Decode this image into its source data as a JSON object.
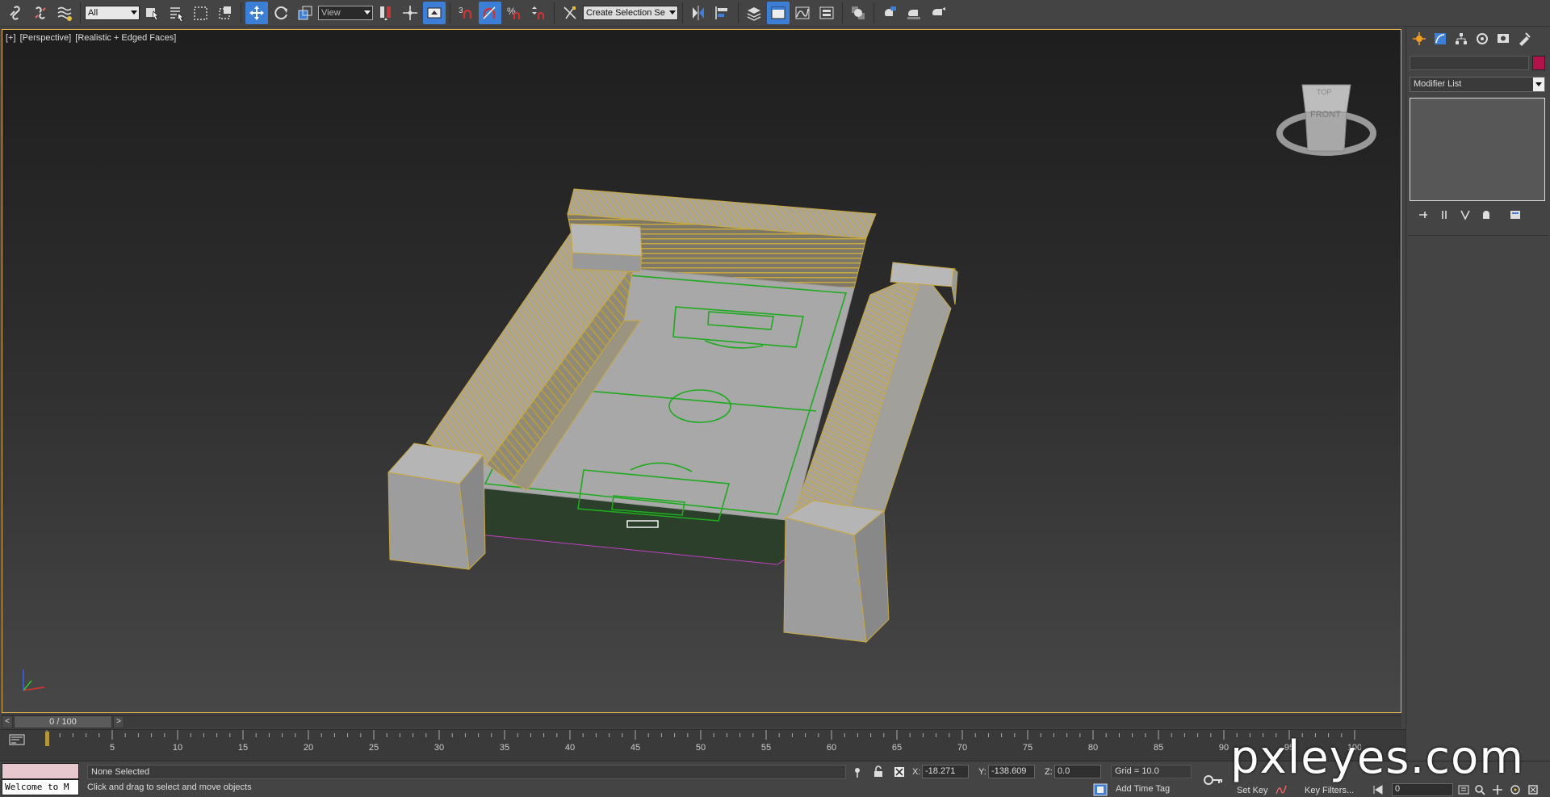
{
  "toolbar": {
    "selection_filter": "All",
    "reference_coord": "View",
    "named_selection": "Create Selection Se"
  },
  "viewport": {
    "label_parts": [
      "[+]",
      "[Perspective]",
      "[Realistic + Edged Faces]"
    ],
    "viewcube": {
      "top_label": "TOP",
      "front_label": "FRONT"
    }
  },
  "command_panel": {
    "modifier_list_label": "Modifier List",
    "object_color": "#b2124a"
  },
  "time_slider": {
    "label": "0 / 100",
    "prev": "<",
    "next": ">",
    "current_frame": 0,
    "total_frames": 100
  },
  "trackbar": {
    "ticks": [
      "5",
      "10",
      "15",
      "20",
      "25",
      "30",
      "35",
      "40",
      "45",
      "50",
      "55",
      "60",
      "65",
      "70",
      "75",
      "80",
      "85",
      "90",
      "95",
      "100"
    ]
  },
  "status": {
    "maxscript_text": "Welcome to M",
    "selection": "None Selected",
    "prompt": "Click and drag to select and move objects",
    "x_label": "X:",
    "x_value": "-18.271",
    "y_label": "Y:",
    "y_value": "-138.609",
    "z_label": "Z:",
    "z_value": "0.0",
    "grid": "Grid = 10.0",
    "add_time_tag": "Add Time Tag",
    "set_key": "Set Key",
    "key_filters": "Key Filters...",
    "frame_value": "0"
  },
  "watermark": "pxleyes.com"
}
